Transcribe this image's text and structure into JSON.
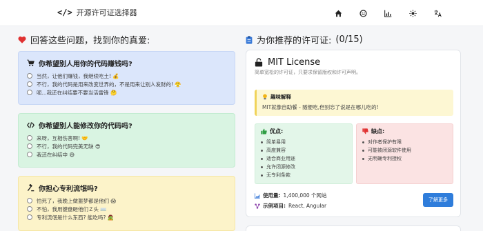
{
  "header": {
    "title": "开源许可证选择器",
    "logo_glyph": "</>",
    "nav_icons": [
      "home-icon",
      "github-icon",
      "chart-icon",
      "sun-icon",
      "translate-icon"
    ]
  },
  "left": {
    "heading": "回答这些问题，找到你的真爱:",
    "questions": [
      {
        "title": "你希望别人用你的代码赚钱吗?",
        "icon": "cart-icon",
        "options": [
          "当然，让他们赚钱，我继续吃土! 💰",
          "不行，我的代码是用来改变世界的，不是用来让别人发财的! 😤",
          "呃...我还在纠结要不要当活雷锋 🤔"
        ]
      },
      {
        "title": "你希望别人能修改你的代码吗?",
        "icon": "code-icon",
        "options": [
          "来呀，互相伤害啊! 🤝",
          "不行，我的代码完美无缺 😎",
          "我还在纠结中 😅"
        ]
      },
      {
        "title": "你担心专利流氓吗?",
        "icon": "gavel-icon",
        "options": [
          "怕死了，我晚上做噩梦都是他们 😱",
          "不怕，我用键盘砸他们Ｚ头 ⌨️",
          "专利流氓是什么东西? 能吃吗? 🧟"
        ]
      }
    ]
  },
  "right": {
    "heading": "为你推荐的许可证:",
    "count": "(0/15)",
    "license": {
      "name": "MIT License",
      "desc": "简单宽松的许可证，只要求保留版权和许可声明。",
      "fun_title": "趣味解释",
      "fun_text": "MIT就像自助餐 - 随便吃,但别忘了说是在哪儿吃的!",
      "pros_title": "优点:",
      "pros": [
        "简单易用",
        "高度兼容",
        "适合商业用途",
        "允许闭源修改",
        "无专利条款"
      ],
      "cons_title": "缺点:",
      "cons": [
        "对作者保护有限",
        "可能被闭源软件使用",
        "无明确专利授权"
      ],
      "usage_label": "使用量:",
      "usage_value": "1,400,000 个网站",
      "projects_label": "示例项目:",
      "projects_value": "React, Angular",
      "more_button": "了解更多"
    }
  },
  "colors": {
    "accent": "#2f7ddb",
    "blue_card": "#dbe6fb",
    "green_card": "#d9f4e2",
    "yellow_card": "#fcf3c9",
    "pros_bg": "#e3f6e9",
    "cons_bg": "#fbe3e3"
  }
}
